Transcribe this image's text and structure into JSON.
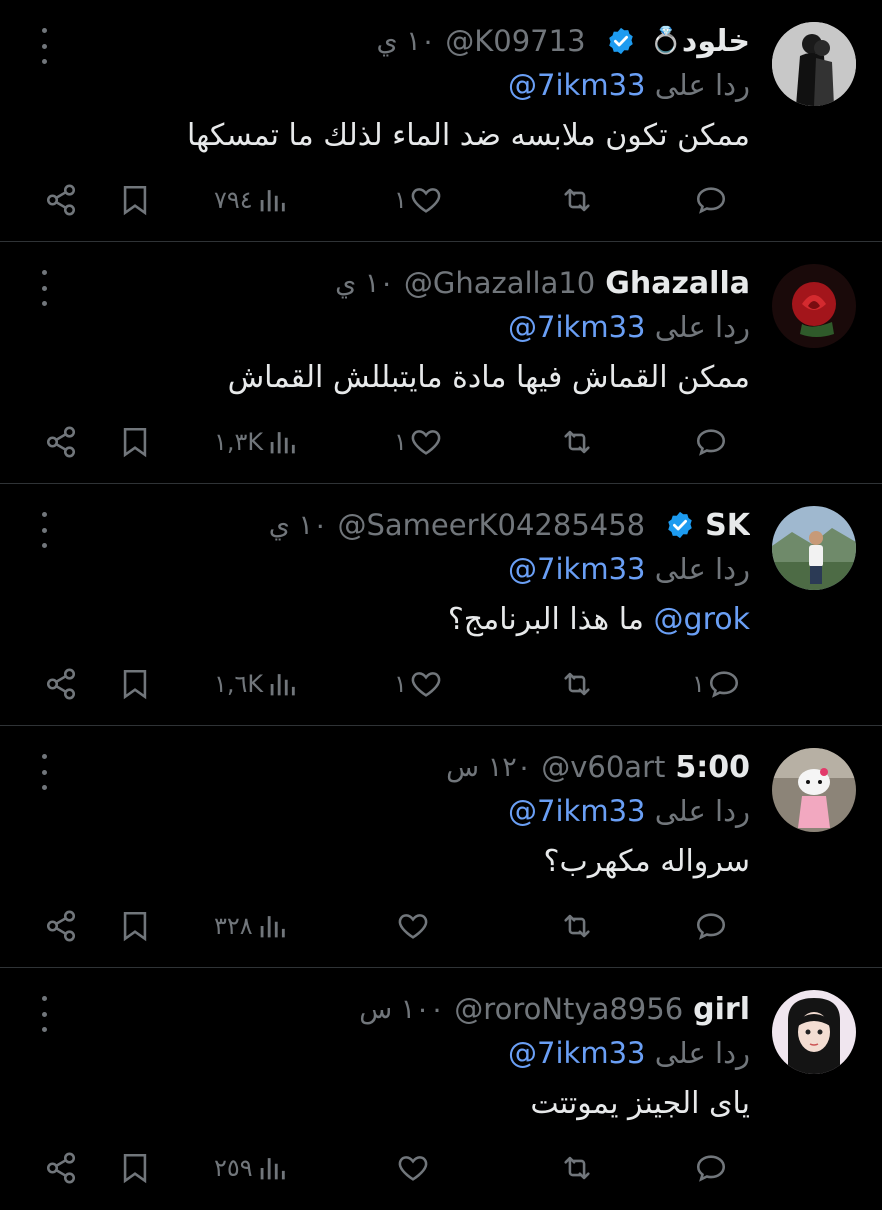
{
  "tweets": [
    {
      "name": "خلود",
      "name_suffix": "💍",
      "verified": true,
      "handle": "@K09713",
      "time": "١٠ ي",
      "reply_prefix": "ردا على",
      "reply_to": "@7ikm33",
      "text_mention": "",
      "text": "ممكن تكون ملابسه ضد الماء لذلك ما تمسكها",
      "replies": "",
      "retweets": "",
      "likes": "١",
      "views": "٧٩٤"
    },
    {
      "name": "Ghazalla",
      "name_suffix": "",
      "verified": false,
      "handle": "@Ghazalla10",
      "time": "١٠ ي",
      "reply_prefix": "ردا على",
      "reply_to": "@7ikm33",
      "text_mention": "",
      "text": "ممكن القماش فيها مادة مايتبللش القماش",
      "replies": "",
      "retweets": "",
      "likes": "١",
      "views": "١,٣K"
    },
    {
      "name": "SK",
      "name_suffix": "",
      "verified": true,
      "handle": "@SameerK04285458",
      "time": "١٠ ي",
      "reply_prefix": "ردا على",
      "reply_to": "@7ikm33",
      "text_mention": "@grok",
      "text": "ما هذا البرنامج؟",
      "replies": "١",
      "retweets": "",
      "likes": "١",
      "views": "١,٦K"
    },
    {
      "name": "5:00",
      "name_suffix": "",
      "verified": false,
      "handle": "@v60art",
      "time": "١٢٠ س",
      "reply_prefix": "ردا على",
      "reply_to": "@7ikm33",
      "text_mention": "",
      "text": "سرواله مكهرب؟",
      "replies": "",
      "retweets": "",
      "likes": "",
      "views": "٣٢٨"
    },
    {
      "name": "girl",
      "name_suffix": "",
      "verified": false,
      "handle": "@roroNtya8956",
      "time": "١٠٠ س",
      "reply_prefix": "ردا على",
      "reply_to": "@7ikm33",
      "text_mention": "",
      "text": "ياى الجينز يموتتت",
      "replies": "",
      "retweets": "",
      "likes": "",
      "views": "٢٥٩"
    }
  ],
  "colors": {
    "background": "#000000",
    "text": "#e7e9ea",
    "muted": "#71767b",
    "link": "#6a9ff5",
    "verified": "#1d9bf0",
    "divider": "#2f3336"
  },
  "icons": [
    "more-icon",
    "verified-badge-icon",
    "share-icon",
    "bookmark-icon",
    "views-icon",
    "like-icon",
    "retweet-icon",
    "reply-icon"
  ]
}
